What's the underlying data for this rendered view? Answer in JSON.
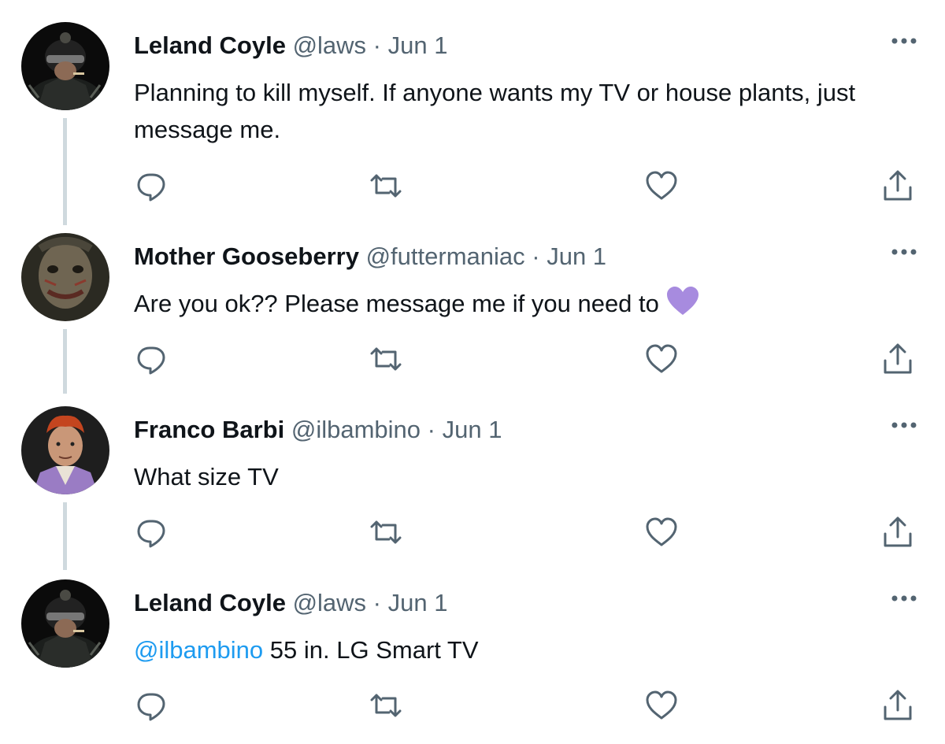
{
  "thread": [
    {
      "name": "Leland Coyle",
      "handle": "@laws",
      "separator": "·",
      "date": "Jun 1",
      "text": "Planning to kill myself. If anyone wants my TV or house plants, just message me.",
      "avatar": "helmeted-soldier-avatar"
    },
    {
      "name": "Mother Gooseberry",
      "handle": "@futtermaniac",
      "separator": "·",
      "date": "Jun 1",
      "text": "Are you ok?? Please message me if you need to",
      "emoji": "purple-heart-emoji",
      "avatar": "masked-face-avatar"
    },
    {
      "name": "Franco Barbi",
      "handle": "@ilbambino",
      "separator": "·",
      "date": "Jun 1",
      "text": "What size TV",
      "avatar": "red-haired-man-avatar"
    },
    {
      "name": "Leland Coyle",
      "handle": "@laws",
      "separator": "·",
      "date": "Jun 1",
      "mention": "@ilbambino",
      "text": " 55 in. LG Smart TV",
      "avatar": "helmeted-soldier-avatar"
    }
  ],
  "actions": [
    "reply-icon",
    "retweet-icon",
    "like-icon",
    "share-icon"
  ],
  "colors": {
    "text": "#0f1419",
    "secondary": "#536471",
    "link": "#1d9bf0",
    "thread_line": "#cfd9de",
    "heart_emoji": "#a78bdf"
  }
}
